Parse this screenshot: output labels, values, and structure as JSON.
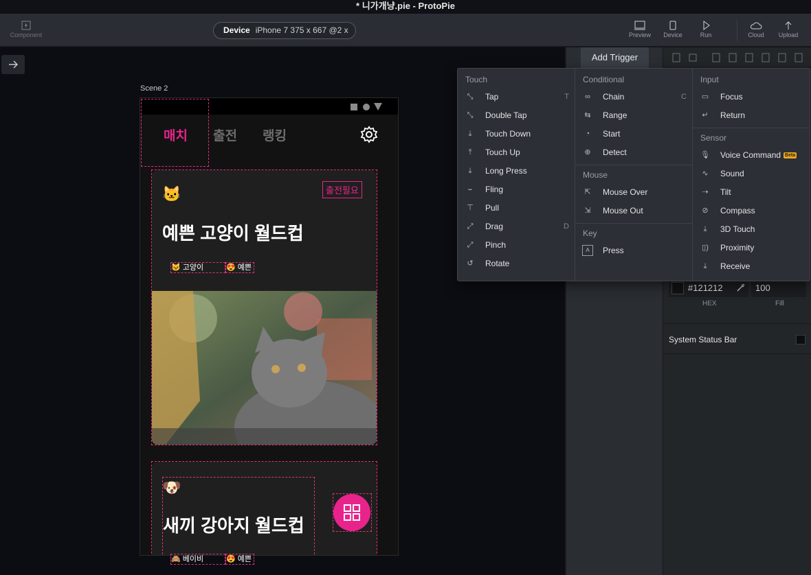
{
  "window": {
    "title": "* 니가개냥.pie - ProtoPie"
  },
  "toolbar": {
    "component_label": "Component",
    "device_label": "Device",
    "device_value": "iPhone 7  375 x 667  @2 x",
    "preview_label": "Preview",
    "device_btn_label": "Device",
    "run_label": "Run",
    "cloud_label": "Cloud",
    "upload_label": "Upload"
  },
  "canvas": {
    "scene_label": "Scene 2",
    "tabs": [
      "매치",
      "출전",
      "랭킹"
    ],
    "card1": {
      "emoji": "🐱",
      "badge": "출전필요",
      "title": "예쁜 고양이 월드컵",
      "tags": [
        "🐱 고양이",
        "😍 예쁜"
      ]
    },
    "card2": {
      "emoji": "🐶",
      "title": "새끼 강아지 월드컵",
      "tags": [
        "🙈 베이비",
        "😍 예쁜"
      ]
    }
  },
  "panel": {
    "add_trigger": "Add Trigger",
    "hex_value": "#121212",
    "fill_value": "100",
    "hex_label": "HEX",
    "fill_label": "Fill",
    "status_bar_label": "System Status Bar"
  },
  "menu": {
    "touch": {
      "header": "Touch",
      "items": [
        {
          "label": "Tap",
          "shortcut": "T"
        },
        {
          "label": "Double Tap",
          "shortcut": ""
        },
        {
          "label": "Touch Down",
          "shortcut": ""
        },
        {
          "label": "Touch Up",
          "shortcut": ""
        },
        {
          "label": "Long Press",
          "shortcut": ""
        },
        {
          "label": "Fling",
          "shortcut": ""
        },
        {
          "label": "Pull",
          "shortcut": ""
        },
        {
          "label": "Drag",
          "shortcut": "D"
        },
        {
          "label": "Pinch",
          "shortcut": ""
        },
        {
          "label": "Rotate",
          "shortcut": ""
        }
      ]
    },
    "conditional": {
      "header": "Conditional",
      "items": [
        {
          "label": "Chain",
          "shortcut": "C"
        },
        {
          "label": "Range",
          "shortcut": ""
        },
        {
          "label": "Start",
          "shortcut": ""
        },
        {
          "label": "Detect",
          "shortcut": ""
        }
      ]
    },
    "mouse": {
      "header": "Mouse",
      "items": [
        "Mouse Over",
        "Mouse Out"
      ]
    },
    "key": {
      "header": "Key",
      "items": [
        "Press"
      ]
    },
    "input": {
      "header": "Input",
      "items": [
        "Focus",
        "Return"
      ]
    },
    "sensor": {
      "header": "Sensor",
      "beta": "Beta",
      "items": [
        "Voice Command",
        "Sound",
        "Tilt",
        "Compass",
        "3D Touch",
        "Proximity",
        "Receive"
      ]
    }
  },
  "colors": {
    "accent": "#e8248c",
    "badge_beta": "#e9a624"
  }
}
